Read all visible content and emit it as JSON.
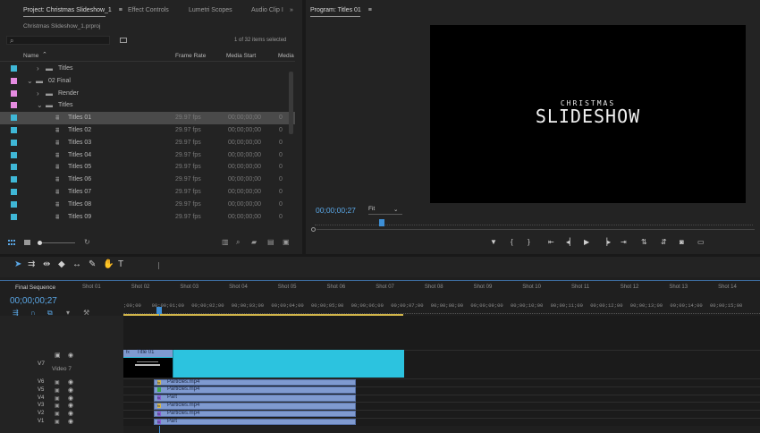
{
  "project_panel": {
    "tabs": [
      {
        "label": "Project: Christmas Slideshow_1",
        "menu": "≡"
      },
      {
        "label": "Effect Controls"
      },
      {
        "label": "Lumetri Scopes"
      },
      {
        "label": "Audio Clip I"
      }
    ],
    "overflow": "»",
    "project_file": "Christmas Slideshow_1.prproj",
    "search_placeholder": "",
    "items_selected": "1 of 32 items selected",
    "columns": {
      "name": "Name",
      "frame_rate": "Frame Rate",
      "media_start": "Media Start",
      "media_dur": "Media"
    },
    "rows": [
      {
        "name": "Titles",
        "type": "folder",
        "indent": 1,
        "expand": "›",
        "color": "#3fb7d6",
        "frame_rate": "",
        "media_start": "",
        "media_dur": ""
      },
      {
        "name": "02 Final",
        "type": "folder",
        "indent": 0,
        "expand": "⌄",
        "color": "#e58be0",
        "frame_rate": "",
        "media_start": "",
        "media_dur": ""
      },
      {
        "name": "Render",
        "type": "folder",
        "indent": 1,
        "expand": "›",
        "color": "#e58be0",
        "frame_rate": "",
        "media_start": "",
        "media_dur": ""
      },
      {
        "name": "Titles",
        "type": "folder",
        "indent": 1,
        "expand": "⌄",
        "color": "#e58be0",
        "frame_rate": "",
        "media_start": "",
        "media_dur": ""
      },
      {
        "name": "Titles 01",
        "type": "title",
        "indent": 2,
        "expand": "",
        "color": "#3fb7d6",
        "frame_rate": "29.97 fps",
        "media_start": "00;00;00;00",
        "media_dur": "0",
        "selected": true
      },
      {
        "name": "Titles 02",
        "type": "title",
        "indent": 2,
        "expand": "",
        "color": "#3fb7d6",
        "frame_rate": "29.97 fps",
        "media_start": "00;00;00;00",
        "media_dur": "0"
      },
      {
        "name": "Titles 03",
        "type": "title",
        "indent": 2,
        "expand": "",
        "color": "#3fb7d6",
        "frame_rate": "29.97 fps",
        "media_start": "00;00;00;00",
        "media_dur": "0"
      },
      {
        "name": "Titles 04",
        "type": "title",
        "indent": 2,
        "expand": "",
        "color": "#3fb7d6",
        "frame_rate": "29.97 fps",
        "media_start": "00;00;00;00",
        "media_dur": "0"
      },
      {
        "name": "Titles 05",
        "type": "title",
        "indent": 2,
        "expand": "",
        "color": "#3fb7d6",
        "frame_rate": "29.97 fps",
        "media_start": "00;00;00;00",
        "media_dur": "0"
      },
      {
        "name": "Titles 06",
        "type": "title",
        "indent": 2,
        "expand": "",
        "color": "#3fb7d6",
        "frame_rate": "29.97 fps",
        "media_start": "00;00;00;00",
        "media_dur": "0"
      },
      {
        "name": "Titles 07",
        "type": "title",
        "indent": 2,
        "expand": "",
        "color": "#3fb7d6",
        "frame_rate": "29.97 fps",
        "media_start": "00;00;00;00",
        "media_dur": "0"
      },
      {
        "name": "Titles 08",
        "type": "title",
        "indent": 2,
        "expand": "",
        "color": "#3fb7d6",
        "frame_rate": "29.97 fps",
        "media_start": "00;00;00;00",
        "media_dur": "0"
      },
      {
        "name": "Titles 09",
        "type": "title",
        "indent": 2,
        "expand": "",
        "color": "#3fb7d6",
        "frame_rate": "29.97 fps",
        "media_start": "00;00;00;00",
        "media_dur": "0"
      }
    ]
  },
  "program_monitor": {
    "title": "Program: Titles 01",
    "menu": "≡",
    "video_line1": "CHRISTMAS",
    "video_line2": "SLIDESHOW",
    "timecode": "00;00;00;27",
    "zoom": "Fit"
  },
  "timeline": {
    "sequence_name": "Final Sequence",
    "timecode": "00;00;00;27",
    "markers": [
      "Shot 01",
      "Shot 02",
      "Shot 03",
      "Shot 04",
      "Shot 05",
      "Shot 06",
      "Shot 07",
      "Shot 08",
      "Shot 09",
      "Shot 10",
      "Shot 11",
      "Shot 12",
      "Shot 13",
      "Shot 14"
    ],
    "ruler": [
      ";00;00",
      "00;00;01;00",
      "00;00;02;00",
      "00;00;03;00",
      "00;00;04;00",
      "00;00;05;00",
      "00;00;06;00",
      "00;00;07;00",
      "00;00;08;00",
      "00;00;09;00",
      "00;00;10;00",
      "00;00;11;00",
      "00;00;12;00",
      "00;00;13;00",
      "00;00;14;00",
      "00;00;15;00"
    ],
    "tracks": [
      {
        "id": "V7",
        "name": "Video 7"
      },
      {
        "id": "V6"
      },
      {
        "id": "V5"
      },
      {
        "id": "V4"
      },
      {
        "id": "V3"
      },
      {
        "id": "V2"
      },
      {
        "id": "V1"
      }
    ],
    "title_clip": {
      "label": "Title 01",
      "badge": "fx",
      "color": "#2cc3df"
    },
    "clips": [
      {
        "label": "Particles.mp4",
        "badge": "fx",
        "badge_color": "#d6b64a"
      },
      {
        "label": "Particles.mp4",
        "badge": "",
        "badge_color": "#3fa84a"
      },
      {
        "label": "Part",
        "badge": "fx",
        "badge_color": "#8a5fd0"
      },
      {
        "label": "Particles.mp4",
        "badge": "fx",
        "badge_color": "#d6b64a"
      },
      {
        "label": "Particles.mp4",
        "badge": "fx",
        "badge_color": "#8a5fd0"
      },
      {
        "label": "Part",
        "badge": "fx",
        "badge_color": "#8a5fd0"
      }
    ]
  },
  "colors": {
    "accent_blue": "#5aa7e6",
    "selection": "#4d4d4d",
    "clip_blue": "#7f9ad0",
    "title_cyan": "#2cc3df"
  }
}
